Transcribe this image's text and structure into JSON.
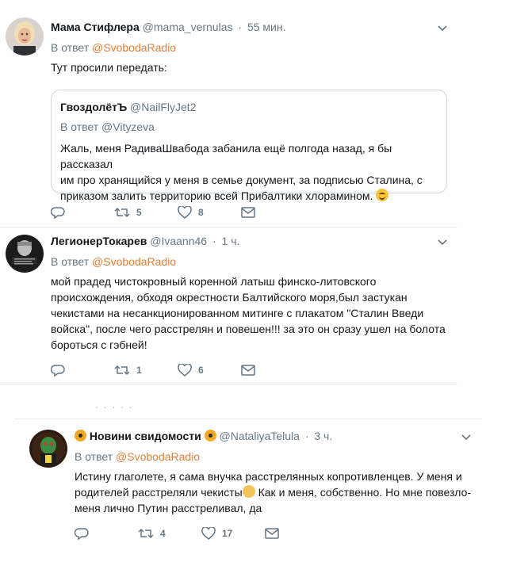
{
  "tweets": [
    {
      "name": "Мама Стифлера",
      "handle": "@mama_vernulas",
      "time": "55 мин.",
      "reply_prefix": "В ответ",
      "reply_to": "@SvobodaRadio",
      "text": "Тут просили передать:",
      "quote": {
        "name": "ГвоздолётЪ",
        "handle": "@NailFlyJet2",
        "reply_prefix": "В ответ",
        "reply_to": "@Vityzeva",
        "text_lines": [
          "Жаль, меня  РадиваШвабода забанила ещё полгода назад, я бы рассказал",
          "им про хранящийся у меня в семье  документ, за подписью Сталина, с",
          "приказом залить территорию всей Прибалтики хлорамином."
        ]
      },
      "retweets": "5",
      "likes": "8"
    },
    {
      "name": "ЛегионерТокарев",
      "handle": "@Ivaann46",
      "time": "1 ч.",
      "reply_prefix": "В ответ",
      "reply_to": "@SvobodaRadio",
      "text_lines": [
        "мой прадед чистокровный коренной латыш финско-литовского",
        "происхождения, обходя окрестности Балтийского моря,был застукан",
        "чекистами на несанкционированном митинге с плакатом \"Сталин Введи",
        "войска\", после чего расстрелян и повешен!!! за это он сразу ушел на болота",
        "бороться с гэбней!"
      ],
      "retweets": "1",
      "likes": "6"
    },
    {
      "name": "Новини свидомости",
      "handle": "@NataliyaTelula",
      "time": "3 ч.",
      "reply_prefix": "В ответ",
      "reply_to": "@SvobodaRadio",
      "text_lines": [
        "Истину глаголете, я сама внучка расстрелянных копротивленцев. У меня и",
        "родителей расстреляли чекисты",
        " Как и меня, собственно. Но мне повезло-",
        "меня лично Путин расстреливал, да"
      ],
      "retweets": "4",
      "likes": "17"
    }
  ],
  "colors": {
    "accent": "#e0803a",
    "muted": "#657786",
    "text": "#14171a",
    "divider": "#e6ecf0"
  },
  "icons": [
    "reply-icon",
    "retweet-icon",
    "like-icon",
    "message-icon",
    "chevron-down-icon"
  ]
}
